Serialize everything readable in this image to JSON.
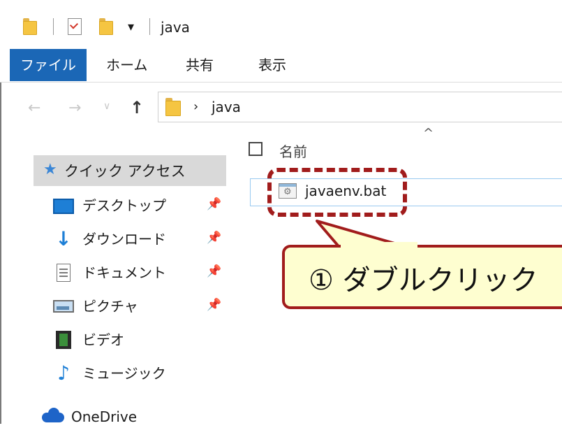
{
  "window": {
    "title": "java"
  },
  "quick_access_toolbar": {
    "dropdown_glyph": "▾"
  },
  "ribbon": {
    "tabs": [
      {
        "label": "ファイル",
        "active": true
      },
      {
        "label": "ホーム"
      },
      {
        "label": "共有"
      },
      {
        "label": "表示"
      }
    ]
  },
  "nav_buttons": {
    "back": "←",
    "forward": "→",
    "recent": "∨",
    "up": "↑"
  },
  "address_bar": {
    "separator": "›",
    "path": "java"
  },
  "content": {
    "sort_indicator": "^",
    "column_header": "名前",
    "files": [
      {
        "name": "javaenv.bat",
        "icon": "batch-file-icon"
      }
    ]
  },
  "nav_pane": {
    "quick_access": {
      "label": "クイック アクセス",
      "icon": "star-icon"
    },
    "items": [
      {
        "label": "デスクトップ",
        "icon": "desktop-icon",
        "pinned": true
      },
      {
        "label": "ダウンロード",
        "icon": "download-icon",
        "pinned": true
      },
      {
        "label": "ドキュメント",
        "icon": "documents-icon",
        "pinned": true
      },
      {
        "label": "ピクチャ",
        "icon": "pictures-icon",
        "pinned": true
      },
      {
        "label": "ビデオ",
        "icon": "video-icon",
        "pinned": false
      },
      {
        "label": "ミュージック",
        "icon": "music-icon",
        "pinned": false
      }
    ],
    "onedrive": {
      "label": "OneDrive",
      "icon": "cloud-icon"
    }
  },
  "annotation": {
    "callout_text": "① ダブルクリック",
    "highlight_color": "#a11c1c",
    "callout_fill": "#fefed0"
  },
  "colors": {
    "accent": "#1b67b6",
    "folder": "#f5c542"
  }
}
